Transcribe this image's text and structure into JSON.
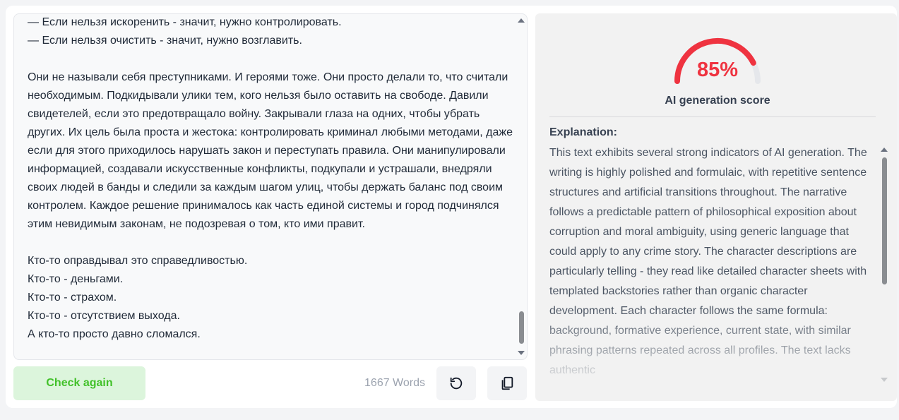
{
  "editor": {
    "text": "— Если нельзя искоренить - значит, нужно контролировать.\n— Если нельзя очистить - значит, нужно возглавить.\n\nОни не называли себя преступниками. И героями тоже. Они просто делали то, что считали необходимым. Подкидывали улики тем, кого нельзя было оставить на свободе. Давили свидетелей, если это предотвращало войну. Закрывали глаза на одних, чтобы убрать других. Их цель была проста и жестока: контролировать криминал любыми методами, даже если для этого приходилось нарушать закон и переступать правила. Они манипулировали информацией, создавали искусственные конфликты, подкупали и устрашали, внедряли своих людей в банды и следили за каждым шагом улиц, чтобы держать баланс под своим контролем. Каждое решение принималось как часть единой системы и город подчинялся этим невидимым законам, не подозревая о том, кто ими правит.\n\nКто-то оправдывал это справедливостью.\nКто-то - деньгами.\nКто-то - страхом.\nКто-то - отсутствием выхода.\nА кто-то просто давно сломался."
  },
  "actions": {
    "check_again_label": "Check again",
    "word_count": "1667 Words",
    "reset_icon": "rotate-ccw-icon",
    "copy_icon": "copy-icon"
  },
  "result": {
    "score_percent": 85,
    "score_text": "85%",
    "score_label": "AI generation score",
    "explanation_title": "Explanation:",
    "explanation": "This text exhibits several strong indicators of AI generation. The writing is highly polished and formulaic, with repetitive sentence structures and artificial transitions throughout. The narrative follows a predictable pattern of philosophical exposition about corruption and moral ambiguity, using generic language that could apply to any crime story. The character descriptions are particularly telling - they read like detailed character sheets with templated backstories rather than organic character development. Each character follows the same formula: background, formative experience, current state, with similar phrasing patterns repeated across all profiles. The text lacks authentic"
  },
  "colors": {
    "accent_red": "#ef3340",
    "gauge_track": "#e5e7eb",
    "button_bg": "#dcf5dc",
    "button_text": "#42c12a"
  }
}
